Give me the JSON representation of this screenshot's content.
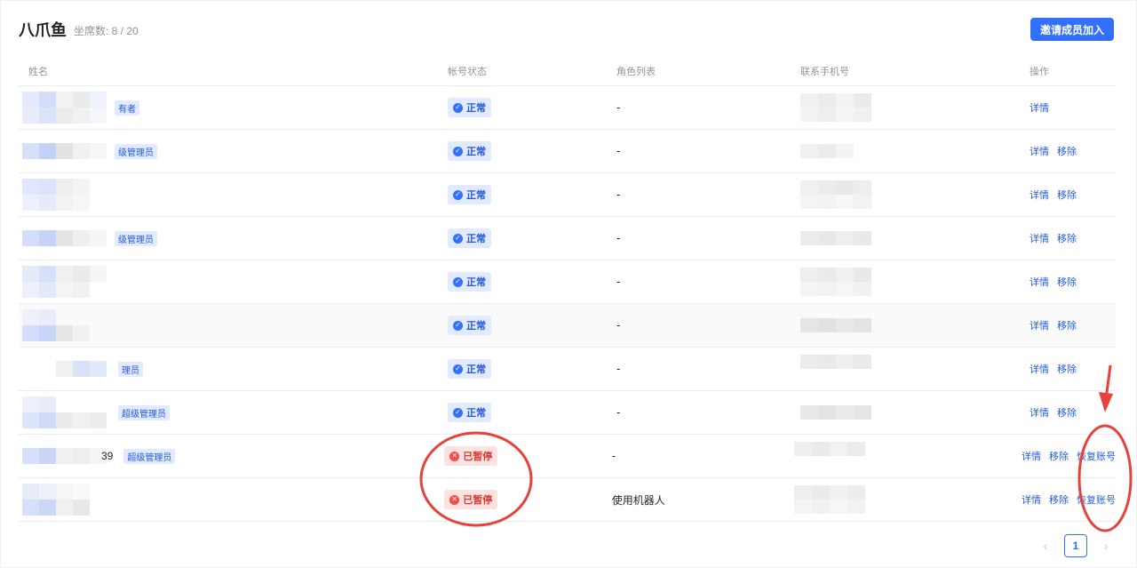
{
  "header": {
    "org_name": "八爪鱼",
    "seat_label": "坐席数: 8 / 20",
    "invite_label": "邀请成员加入"
  },
  "table": {
    "columns": [
      "姓名",
      "帐号状态",
      "角色列表",
      "联系手机号",
      "操作"
    ],
    "rows": [
      {
        "name_tail": "",
        "role_tag": "有者",
        "status": "正常",
        "role": "-",
        "ops": [
          "详情"
        ]
      },
      {
        "name_tail": "",
        "role_tag": "级管理员",
        "status": "正常",
        "role": "-",
        "ops": [
          "详情",
          "移除"
        ]
      },
      {
        "name_tail": "",
        "role_tag": "",
        "status": "正常",
        "role": "-",
        "ops": [
          "详情",
          "移除"
        ]
      },
      {
        "name_tail": "",
        "role_tag": "级管理员",
        "status": "正常",
        "role": "-",
        "ops": [
          "详情",
          "移除"
        ]
      },
      {
        "name_tail": "",
        "role_tag": "",
        "status": "正常",
        "role": "-",
        "ops": [
          "详情",
          "移除"
        ]
      },
      {
        "name_tail": "",
        "role_tag": "",
        "status": "正常",
        "role": "-",
        "ops": [
          "详情",
          "移除"
        ]
      },
      {
        "name_tail": "",
        "role_tag": "理员",
        "status": "正常",
        "role": "-",
        "ops": [
          "详情",
          "移除"
        ]
      },
      {
        "name_tail": "",
        "role_tag": "超级管理员",
        "status": "正常",
        "role": "-",
        "ops": [
          "详情",
          "移除"
        ]
      },
      {
        "name_tail": "39",
        "role_tag": "超级管理员",
        "status": "已暂停",
        "role": "-",
        "ops": [
          "详情",
          "移除",
          "恢复账号"
        ]
      },
      {
        "name_tail": "",
        "role_tag": "",
        "status": "已暂停",
        "role": "使用机器人",
        "ops": [
          "详情",
          "移除",
          "恢复账号"
        ]
      }
    ]
  },
  "pagination": {
    "current_page": "1",
    "prev_icon": "chevron-left-icon",
    "next_icon": "chevron-right-icon"
  },
  "colors": {
    "primary": "#3370ff",
    "ok_bg": "#e1eaff",
    "stop_bg": "#fde2e2",
    "annotation": "#e8403a"
  }
}
